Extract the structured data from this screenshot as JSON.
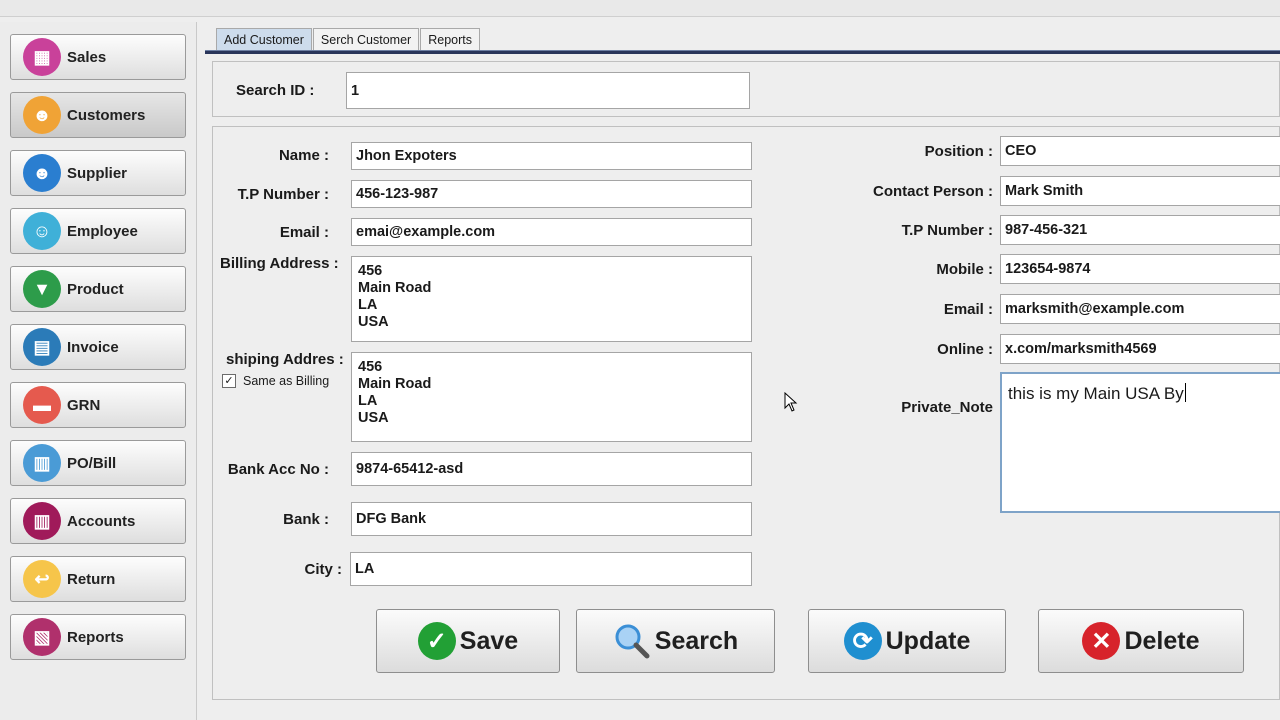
{
  "sidebar": {
    "items": [
      {
        "label": "Sales",
        "icon": "basket-icon",
        "color": "#c9419a"
      },
      {
        "label": "Customers",
        "icon": "customer-person-icon",
        "color": "#f0a336"
      },
      {
        "label": "Supplier",
        "icon": "supplier-worker-icon",
        "color": "#2a7ed0"
      },
      {
        "label": "Employee",
        "icon": "employee-person-icon",
        "color": "#3fb0d8"
      },
      {
        "label": "Product",
        "icon": "tshirt-icon",
        "color": "#2d9c4a"
      },
      {
        "label": "Invoice",
        "icon": "invoice-clipboard-icon",
        "color": "#2b7bb8"
      },
      {
        "label": "GRN",
        "icon": "grn-document-icon",
        "color": "#e55a4e"
      },
      {
        "label": "PO/Bill",
        "icon": "notebook-icon",
        "color": "#4a9bd6"
      },
      {
        "label": "Accounts",
        "icon": "bank-icon",
        "color": "#a01a5a"
      },
      {
        "label": "Return",
        "icon": "return-arrow-icon",
        "color": "#f6c54a"
      },
      {
        "label": "Reports",
        "icon": "reports-icon",
        "color": "#b0306c"
      }
    ],
    "active_index": 1
  },
  "tabs": [
    "Add Customer",
    "Serch Customer",
    "Reports"
  ],
  "search": {
    "label": "Search ID :",
    "value": "1"
  },
  "form": {
    "name": {
      "label": "Name :",
      "value": "Jhon Expoters"
    },
    "tp_number": {
      "label": "T.P Number :",
      "value": "456-123-987"
    },
    "email": {
      "label": "Email :",
      "value": "emai@example.com"
    },
    "billing": {
      "label": "Billing Address :",
      "lines": [
        "456",
        "Main Road",
        "LA",
        "USA"
      ]
    },
    "shipping": {
      "label": "shiping Addres :",
      "lines": [
        "456",
        "Main Road",
        "LA",
        "USA"
      ],
      "same_label": "Same as Billing",
      "same_checked": true
    },
    "bank_acc": {
      "label": "Bank Acc No :",
      "value": "9874-65412-asd"
    },
    "bank": {
      "label": "Bank :",
      "value": "DFG Bank"
    },
    "city": {
      "label": "City :",
      "value": "LA"
    }
  },
  "contact": {
    "position": {
      "label": "Position :",
      "value": "CEO"
    },
    "contact_person": {
      "label": "Contact Person :",
      "value": "Mark Smith"
    },
    "tp_number": {
      "label": "T.P Number :",
      "value": "987-456-321"
    },
    "mobile": {
      "label": "Mobile :",
      "value": "123654-9874"
    },
    "email": {
      "label": "Email :",
      "value": "marksmith@example.com"
    },
    "online": {
      "label": "Online :",
      "value": "x.com/marksmith4569"
    },
    "private_note": {
      "label": "Private_Note",
      "value": "this is my Main USA By"
    }
  },
  "actions": {
    "save": {
      "label": "Save",
      "color": "#22a035"
    },
    "search": {
      "label": "Search",
      "color": "#3b8fd6"
    },
    "update": {
      "label": "Update",
      "color": "#1f8fd0"
    },
    "delete": {
      "label": "Delete",
      "color": "#d7232b"
    }
  }
}
